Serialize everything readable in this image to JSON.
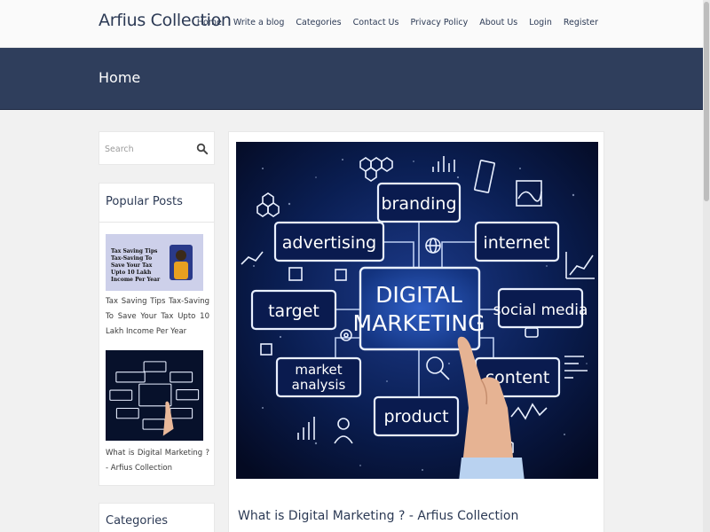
{
  "site": {
    "brand": "Arfius Collection"
  },
  "nav": {
    "items": [
      "Home",
      "Write a blog",
      "Categories",
      "Contact Us",
      "Privacy Policy",
      "About Us",
      "Login",
      "Register"
    ]
  },
  "banner": {
    "title": "Home"
  },
  "search": {
    "placeholder": "Search"
  },
  "popular": {
    "title": "Popular Posts",
    "posts": [
      {
        "title": "Tax Saving Tips Tax-Saving To Save Your Tax Upto 10 Lakh Income Per Year",
        "thumb_text": "Tax Saving Tips Tax-Saving To Save Your Tax Upto 10 Lakh Income Per Year"
      },
      {
        "title": "What is Digital Marketing ? - Arfius Collection"
      }
    ]
  },
  "categories": {
    "title": "Categories"
  },
  "article": {
    "title": "What is Digital Marketing ? - Arfius Collection",
    "hero": {
      "center_line1": "DIGITAL",
      "center_line2": "MARKETING",
      "labels": [
        "branding",
        "advertising",
        "internet",
        "target",
        "social media",
        "market",
        "analysis",
        "content",
        "product"
      ]
    }
  },
  "colors": {
    "brand": "#2c3a55",
    "banner": "#2f3e5c",
    "hero_bg": "#061236",
    "hero_box": "#e9f0ff"
  },
  "icons": {
    "search": "search-icon"
  }
}
